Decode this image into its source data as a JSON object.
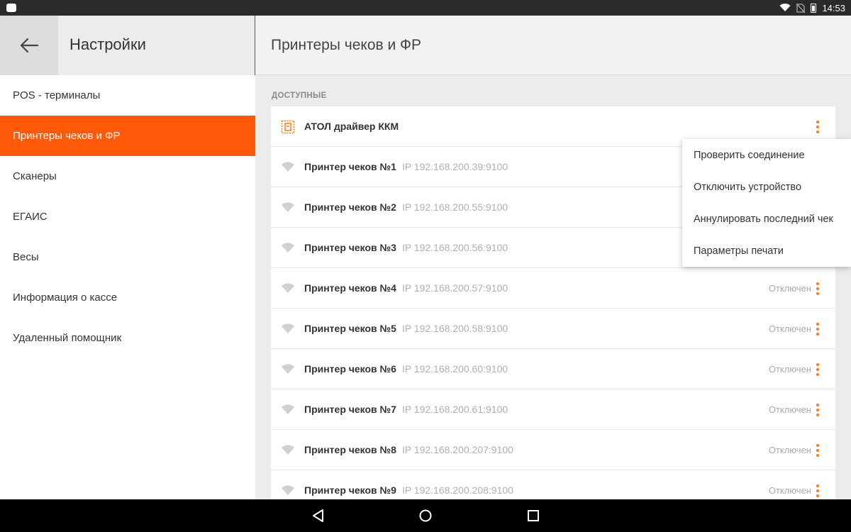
{
  "status_bar": {
    "time": "14:53",
    "icons": [
      "wifi-icon",
      "no-sim-icon",
      "battery-icon"
    ]
  },
  "settings": {
    "back_icon": "arrow-back-icon",
    "title": "Настройки"
  },
  "sidebar": {
    "items": [
      {
        "label": "POS - терминалы",
        "active": false
      },
      {
        "label": "Принтеры чеков и ФР",
        "active": true
      },
      {
        "label": "Сканеры",
        "active": false
      },
      {
        "label": "ЕГАИС",
        "active": false
      },
      {
        "label": "Весы",
        "active": false
      },
      {
        "label": "Информация о кассе",
        "active": false
      },
      {
        "label": "Удаленный помощник",
        "active": false
      }
    ]
  },
  "main": {
    "title": "Принтеры чеков и ФР",
    "section_label": "ДОСТУПНЫЕ",
    "printers": [
      {
        "name": "АТОЛ драйвер ККМ",
        "ip": "",
        "status": "",
        "icon": "atol-driver-icon"
      },
      {
        "name": "Принтер чеков №1",
        "ip": "IP 192.168.200.39:9100",
        "status": "",
        "icon": "wifi-icon"
      },
      {
        "name": "Принтер чеков №2",
        "ip": "IP 192.168.200.55:9100",
        "status": "",
        "icon": "wifi-icon"
      },
      {
        "name": "Принтер чеков №3",
        "ip": "IP 192.168.200.56:9100",
        "status": "",
        "icon": "wifi-icon"
      },
      {
        "name": "Принтер чеков №4",
        "ip": "IP 192.168.200.57:9100",
        "status": "Отключен",
        "icon": "wifi-icon"
      },
      {
        "name": "Принтер чеков №5",
        "ip": "IP 192.168.200.58:9100",
        "status": "Отключен",
        "icon": "wifi-icon"
      },
      {
        "name": "Принтер чеков №6",
        "ip": "IP 192.168.200.60:9100",
        "status": "Отключен",
        "icon": "wifi-icon"
      },
      {
        "name": "Принтер чеков №7",
        "ip": "IP 192.168.200.61:9100",
        "status": "Отключен",
        "icon": "wifi-icon"
      },
      {
        "name": "Принтер чеков №8",
        "ip": "IP 192.168.200.207:9100",
        "status": "Отключен",
        "icon": "wifi-icon"
      },
      {
        "name": "Принтер чеков №9",
        "ip": "IP 192.168.200.208:9100",
        "status": "Отключен",
        "icon": "wifi-icon"
      }
    ]
  },
  "context_menu": {
    "items": [
      "Проверить соединение",
      "Отключить устройство",
      "Аннулировать последний чек",
      "Параметры печати"
    ]
  },
  "navigation_bar": {
    "icons": [
      "back-triangle-icon",
      "home-circle-icon",
      "recents-square-icon"
    ]
  },
  "colors": {
    "accent": "#ff5a0a",
    "more_dots": "#ff7a1a",
    "status_bar": "#2a2a2a"
  }
}
